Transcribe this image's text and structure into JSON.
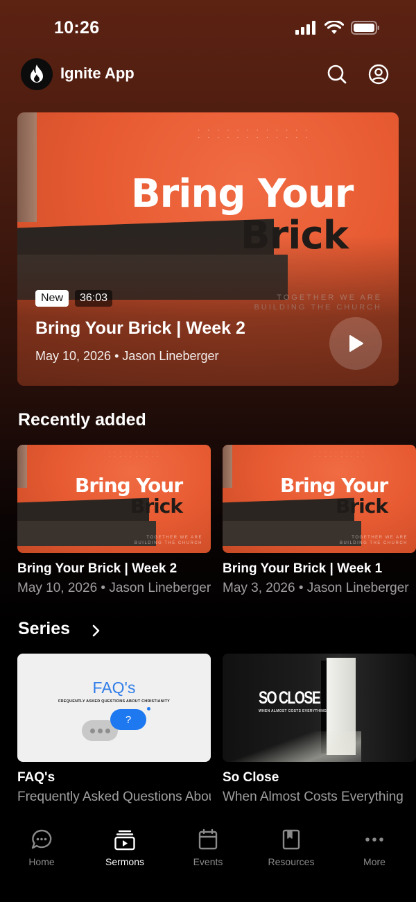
{
  "status_bar": {
    "time": "10:26"
  },
  "header": {
    "title": "Ignite App"
  },
  "hero": {
    "artwork_title_line1": "Bring Your",
    "artwork_title_line2": "Brick",
    "artwork_subtitle_line1": "TOGETHER WE ARE",
    "artwork_subtitle_line2": "BUILDING THE CHURCH",
    "badge": "New",
    "duration": "36:03",
    "title": "Bring Your Brick | Week 2",
    "meta": "May 10, 2026 • Jason Lineberger"
  },
  "recently_added": {
    "heading": "Recently added",
    "items": [
      {
        "title": "Bring Your Brick | Week 2",
        "meta": "May 10, 2026 • Jason Lineberger"
      },
      {
        "title": "Bring Your Brick | Week 1",
        "meta": "May 3, 2026 • Jason Lineberger"
      }
    ]
  },
  "series": {
    "heading": "Series",
    "items": [
      {
        "title": "FAQ's",
        "subtitle": "Frequently Asked Questions About Christianity",
        "art_title": "FAQ's",
        "art_subtitle": "FREQUENTLY ASKED QUESTIONS ABOUT CHRISTIANITY",
        "bubble_text": "?"
      },
      {
        "title": "So Close",
        "subtitle": "When Almost Costs Everything",
        "art_title": "SO CLOSE",
        "art_subtitle": "WHEN ALMOST COSTS EVERYTHING"
      }
    ]
  },
  "tabbar": {
    "tabs": [
      {
        "label": "Home",
        "icon": "chat-bubble-icon",
        "active": false
      },
      {
        "label": "Sermons",
        "icon": "video-library-icon",
        "active": true
      },
      {
        "label": "Events",
        "icon": "calendar-icon",
        "active": false
      },
      {
        "label": "Resources",
        "icon": "book-icon",
        "active": false
      },
      {
        "label": "More",
        "icon": "more-dots-icon",
        "active": false
      }
    ]
  },
  "colors": {
    "accent_orange": "#e85b32",
    "background": "#000000",
    "header_brown": "#5c2212"
  }
}
